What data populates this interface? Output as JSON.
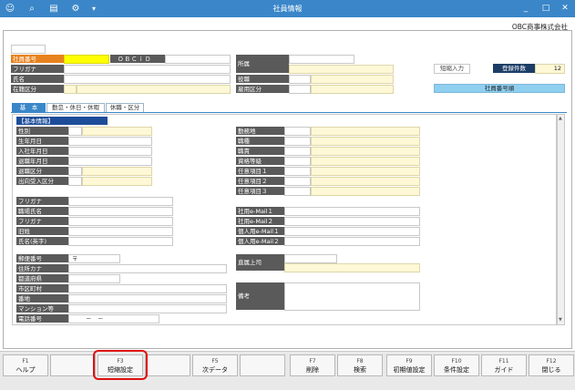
{
  "window": {
    "title": "社員情報",
    "minimize": "_",
    "maximize": "□",
    "close": "✕"
  },
  "toolbar": [
    "user-add-icon",
    "search-doc-icon",
    "print-icon",
    "settings-person-icon",
    "dropdown-icon"
  ],
  "company": "OBC商事株式会社",
  "header": {
    "employee_no_label": "社員番号",
    "employee_no_value": "",
    "obcid_label": "ＯＢＣｉＤ",
    "obcid_value": "",
    "furigana_label": "フリガナ",
    "name_label": "氏名",
    "status_label": "在籍区分",
    "dept_label": "所属",
    "post_label": "役職",
    "employment_label": "雇用区分",
    "short_input": "短縮入力",
    "count_label": "登録件数",
    "count_value": "12",
    "sort_label": "社員番号順"
  },
  "tabs": [
    "基　本",
    "勤怠・休日・休暇",
    "休職・区分"
  ],
  "section_title": "【基本情報】",
  "left_fields": [
    "性別",
    "生年月日",
    "入社年月日",
    "退職年月日",
    "退職区分",
    "出向受入区分"
  ],
  "right_fields": [
    "勤務地",
    "職種",
    "職責",
    "資格等級",
    "任意項目１",
    "任意項目２",
    "任意項目３"
  ],
  "name_fields": [
    "フリガナ",
    "職場氏名",
    "フリガナ",
    "旧姓",
    "氏名(英字)"
  ],
  "email_fields": [
    "社用e-Mail１",
    "社用e-Mail２",
    "個人用e-Mail１",
    "個人用e-Mail２"
  ],
  "address_fields": [
    "郵便番号",
    "住所カナ",
    "都道府県",
    "市区町村",
    "番地",
    "マンション等",
    "電話番号"
  ],
  "postal_mark": "〒",
  "phone_value": "－　－",
  "boss_label": "直属上司",
  "note_label": "備考",
  "fkeys": [
    {
      "key": "F1",
      "label": "ヘルプ"
    },
    {
      "key": "",
      "label": ""
    },
    {
      "key": "F3",
      "label": "短縮設定"
    },
    {
      "key": "",
      "label": ""
    },
    {
      "key": "F5",
      "label": "次データ"
    },
    {
      "key": "",
      "label": ""
    },
    {
      "key": "F7",
      "label": "削除"
    },
    {
      "key": "F8",
      "label": "検索"
    },
    {
      "key": "F9",
      "label": "初期値設定"
    },
    {
      "key": "F10",
      "label": "条件設定"
    },
    {
      "key": "F11",
      "label": "ガイド"
    },
    {
      "key": "F12",
      "label": "閉じる"
    }
  ],
  "highlight_color": "#e01010"
}
